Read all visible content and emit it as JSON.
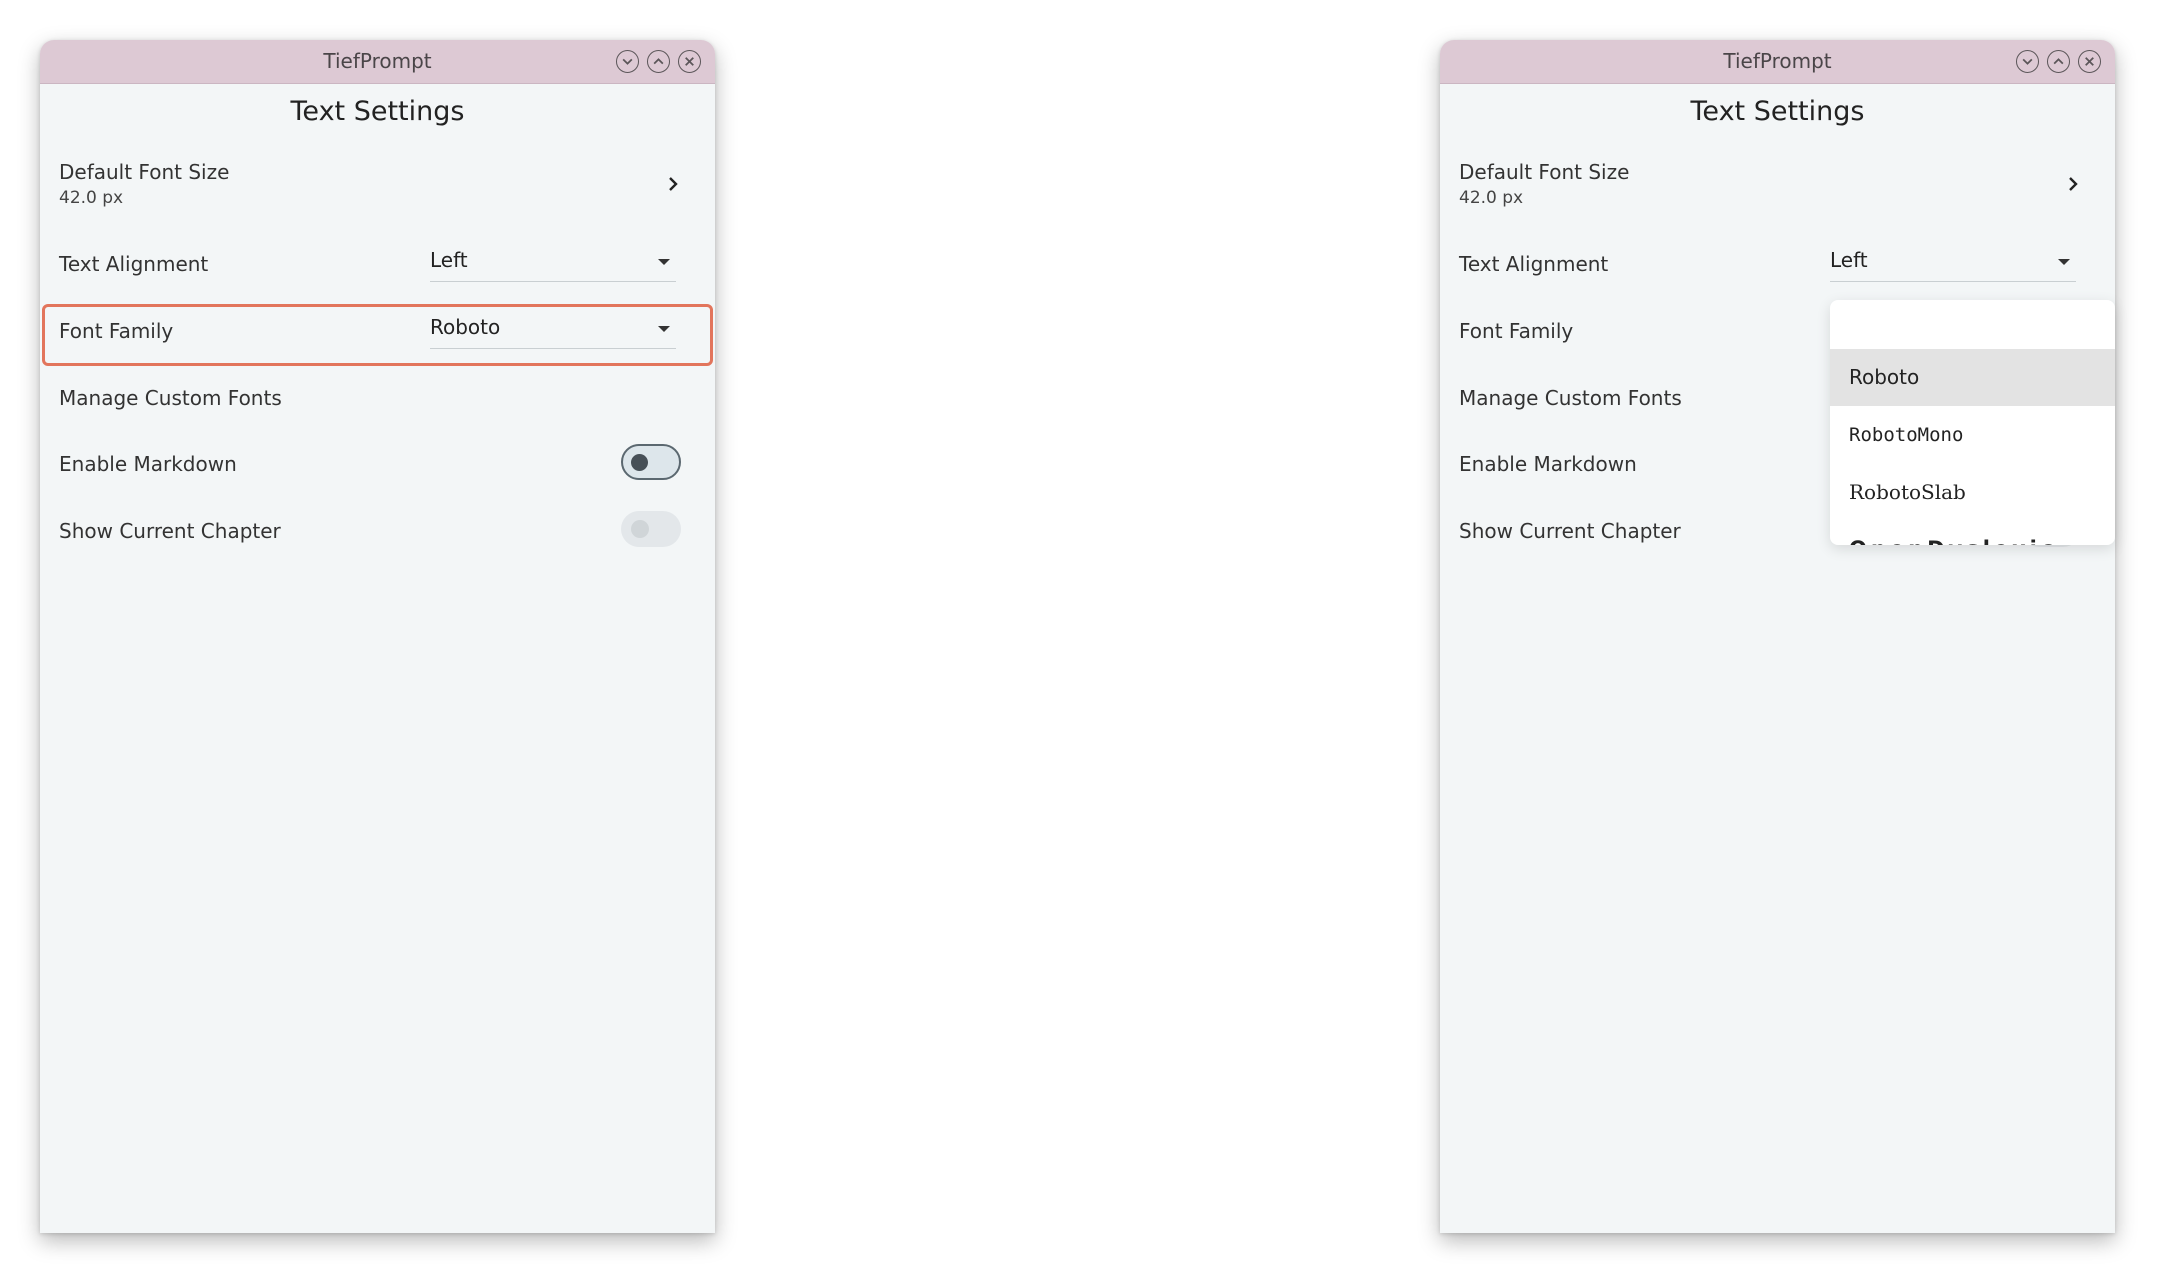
{
  "window": {
    "title": "TiefPrompt",
    "controls": [
      "minimize-icon",
      "maximize-icon",
      "close-icon"
    ]
  },
  "page_title": "Text Settings",
  "settings": {
    "default_font_size": {
      "label": "Default Font Size",
      "value": "42.0 px"
    },
    "text_alignment": {
      "label": "Text Alignment",
      "value": "Left"
    },
    "font_family": {
      "label": "Font Family",
      "value": "Roboto"
    },
    "manage_fonts": {
      "label": "Manage Custom Fonts"
    },
    "enable_markdown": {
      "label": "Enable Markdown",
      "state": "off"
    },
    "show_chapter": {
      "label": "Show Current Chapter",
      "state": "disabled"
    }
  },
  "font_options": [
    "Roboto",
    "RobotoMono",
    "RobotoSlab",
    "OpenDyslexic"
  ],
  "font_options_selected": "Roboto",
  "colors": {
    "titlebar": "#ddc9d4",
    "background": "#f3f6f7",
    "highlight": "#e2755c"
  }
}
